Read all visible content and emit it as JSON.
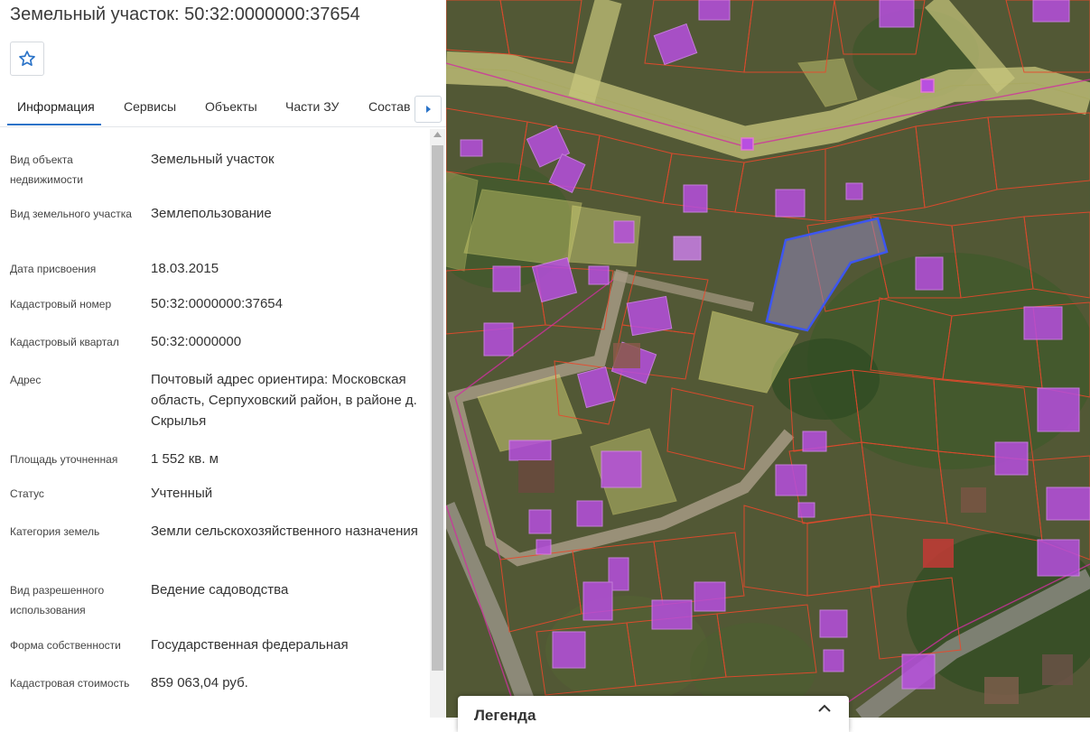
{
  "header": {
    "title": "Земельный участок: 50:32:0000000:37654",
    "favorite_icon": "star-outline-icon"
  },
  "tabs": [
    {
      "label": "Информация",
      "active": true
    },
    {
      "label": "Сервисы",
      "active": false
    },
    {
      "label": "Объекты",
      "active": false
    },
    {
      "label": "Части ЗУ",
      "active": false
    },
    {
      "label": "Состав",
      "active": false
    }
  ],
  "tabs_scroll_icon": "caret-right-icon",
  "info": [
    {
      "label": "Вид объекта недвижимости",
      "value": "Земельный участок"
    },
    {
      "label": "Вид земельного участка",
      "value": "Землепользование"
    },
    {
      "label": "Дата присвоения",
      "value": "18.03.2015"
    },
    {
      "label": "Кадастровый номер",
      "value": "50:32:0000000:37654"
    },
    {
      "label": "Кадастровый квартал",
      "value": "50:32:0000000"
    },
    {
      "label": "Адрес",
      "value": "Почтовый адрес ориентира: Московская область, Серпуховский район, в районе д. Скрылья"
    },
    {
      "label": "Площадь уточненная",
      "value": "1 552 кв. м"
    },
    {
      "label": "Статус",
      "value": "Учтенный"
    },
    {
      "label": "Категория земель",
      "value": "Земли сельскохозяйственного назначения"
    },
    {
      "label": "Вид разрешенного использования",
      "value": "Ведение садоводства"
    },
    {
      "label": "Форма собственности",
      "value": "Государственная федеральная"
    },
    {
      "label": "Кадастровая стоимость",
      "value": "859 063,04 руб."
    }
  ],
  "legend": {
    "title": "Легенда",
    "toggle_icon": "chevron-up-icon"
  },
  "colors": {
    "accent": "#2a73c8",
    "parcel_border": "#e8492c",
    "building_fill": "#b84fe0",
    "selected_parcel_border": "#3d56f0",
    "road_fill": "#c9c77e"
  }
}
